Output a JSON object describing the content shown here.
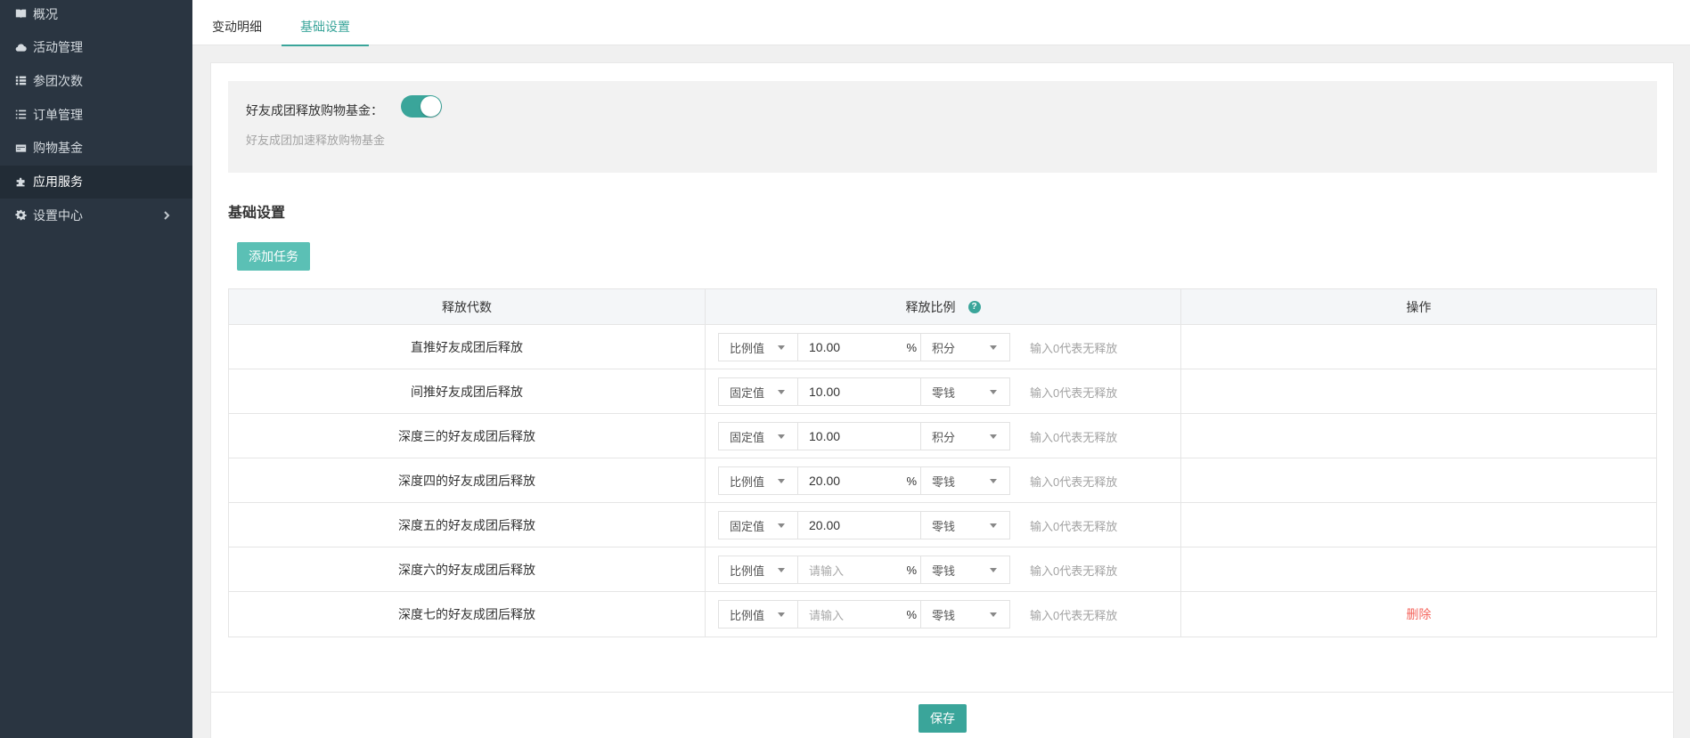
{
  "sidebar": {
    "items": [
      {
        "label": "概况",
        "icon": "book-icon"
      },
      {
        "label": "活动管理",
        "icon": "cloud-icon"
      },
      {
        "label": "参团次数",
        "icon": "list-icon"
      },
      {
        "label": "订单管理",
        "icon": "list-icon"
      },
      {
        "label": "购物基金",
        "icon": "card-icon"
      },
      {
        "label": "应用服务",
        "icon": "puzzle-icon"
      },
      {
        "label": "设置中心",
        "icon": "gear-icon"
      }
    ],
    "active_index": 5
  },
  "tabs": [
    {
      "label": "变动明细"
    },
    {
      "label": "基础设置"
    }
  ],
  "notice": {
    "label": "好友成团释放购物基金：",
    "toggle_on": true,
    "description": "好友成团加速释放购物基金"
  },
  "section_title": "基础设置",
  "add_button": "添加任务",
  "table": {
    "headers": [
      "释放代数",
      "释放比例",
      "操作"
    ],
    "rows": [
      {
        "name": "直推好友成团后释放",
        "type": "比例值",
        "value": "10.00",
        "placeholder": "",
        "percent": "%",
        "unit": "积分",
        "hint": "输入0代表无释放",
        "action": ""
      },
      {
        "name": "间推好友成团后释放",
        "type": "固定值",
        "value": "10.00",
        "placeholder": "",
        "percent": "",
        "unit": "零钱",
        "hint": "输入0代表无释放",
        "action": ""
      },
      {
        "name": "深度三的好友成团后释放",
        "type": "固定值",
        "value": "10.00",
        "placeholder": "",
        "percent": "",
        "unit": "积分",
        "hint": "输入0代表无释放",
        "action": ""
      },
      {
        "name": "深度四的好友成团后释放",
        "type": "比例值",
        "value": "20.00",
        "placeholder": "",
        "percent": "%",
        "unit": "零钱",
        "hint": "输入0代表无释放",
        "action": ""
      },
      {
        "name": "深度五的好友成团后释放",
        "type": "固定值",
        "value": "20.00",
        "placeholder": "",
        "percent": "",
        "unit": "零钱",
        "hint": "输入0代表无释放",
        "action": ""
      },
      {
        "name": "深度六的好友成团后释放",
        "type": "比例值",
        "value": "",
        "placeholder": "请输入",
        "percent": "%",
        "unit": "零钱",
        "hint": "输入0代表无释放",
        "action": ""
      },
      {
        "name": "深度七的好友成团后释放",
        "type": "比例值",
        "value": "",
        "placeholder": "请输入",
        "percent": "%",
        "unit": "零钱",
        "hint": "输入0代表无释放",
        "action": "删除"
      }
    ]
  },
  "save_button": "保存",
  "colors": {
    "accent": "#3aa59a",
    "add_button": "#5bc0b5",
    "sidebar_bg": "#2a3541",
    "delete": "#f5675f"
  }
}
